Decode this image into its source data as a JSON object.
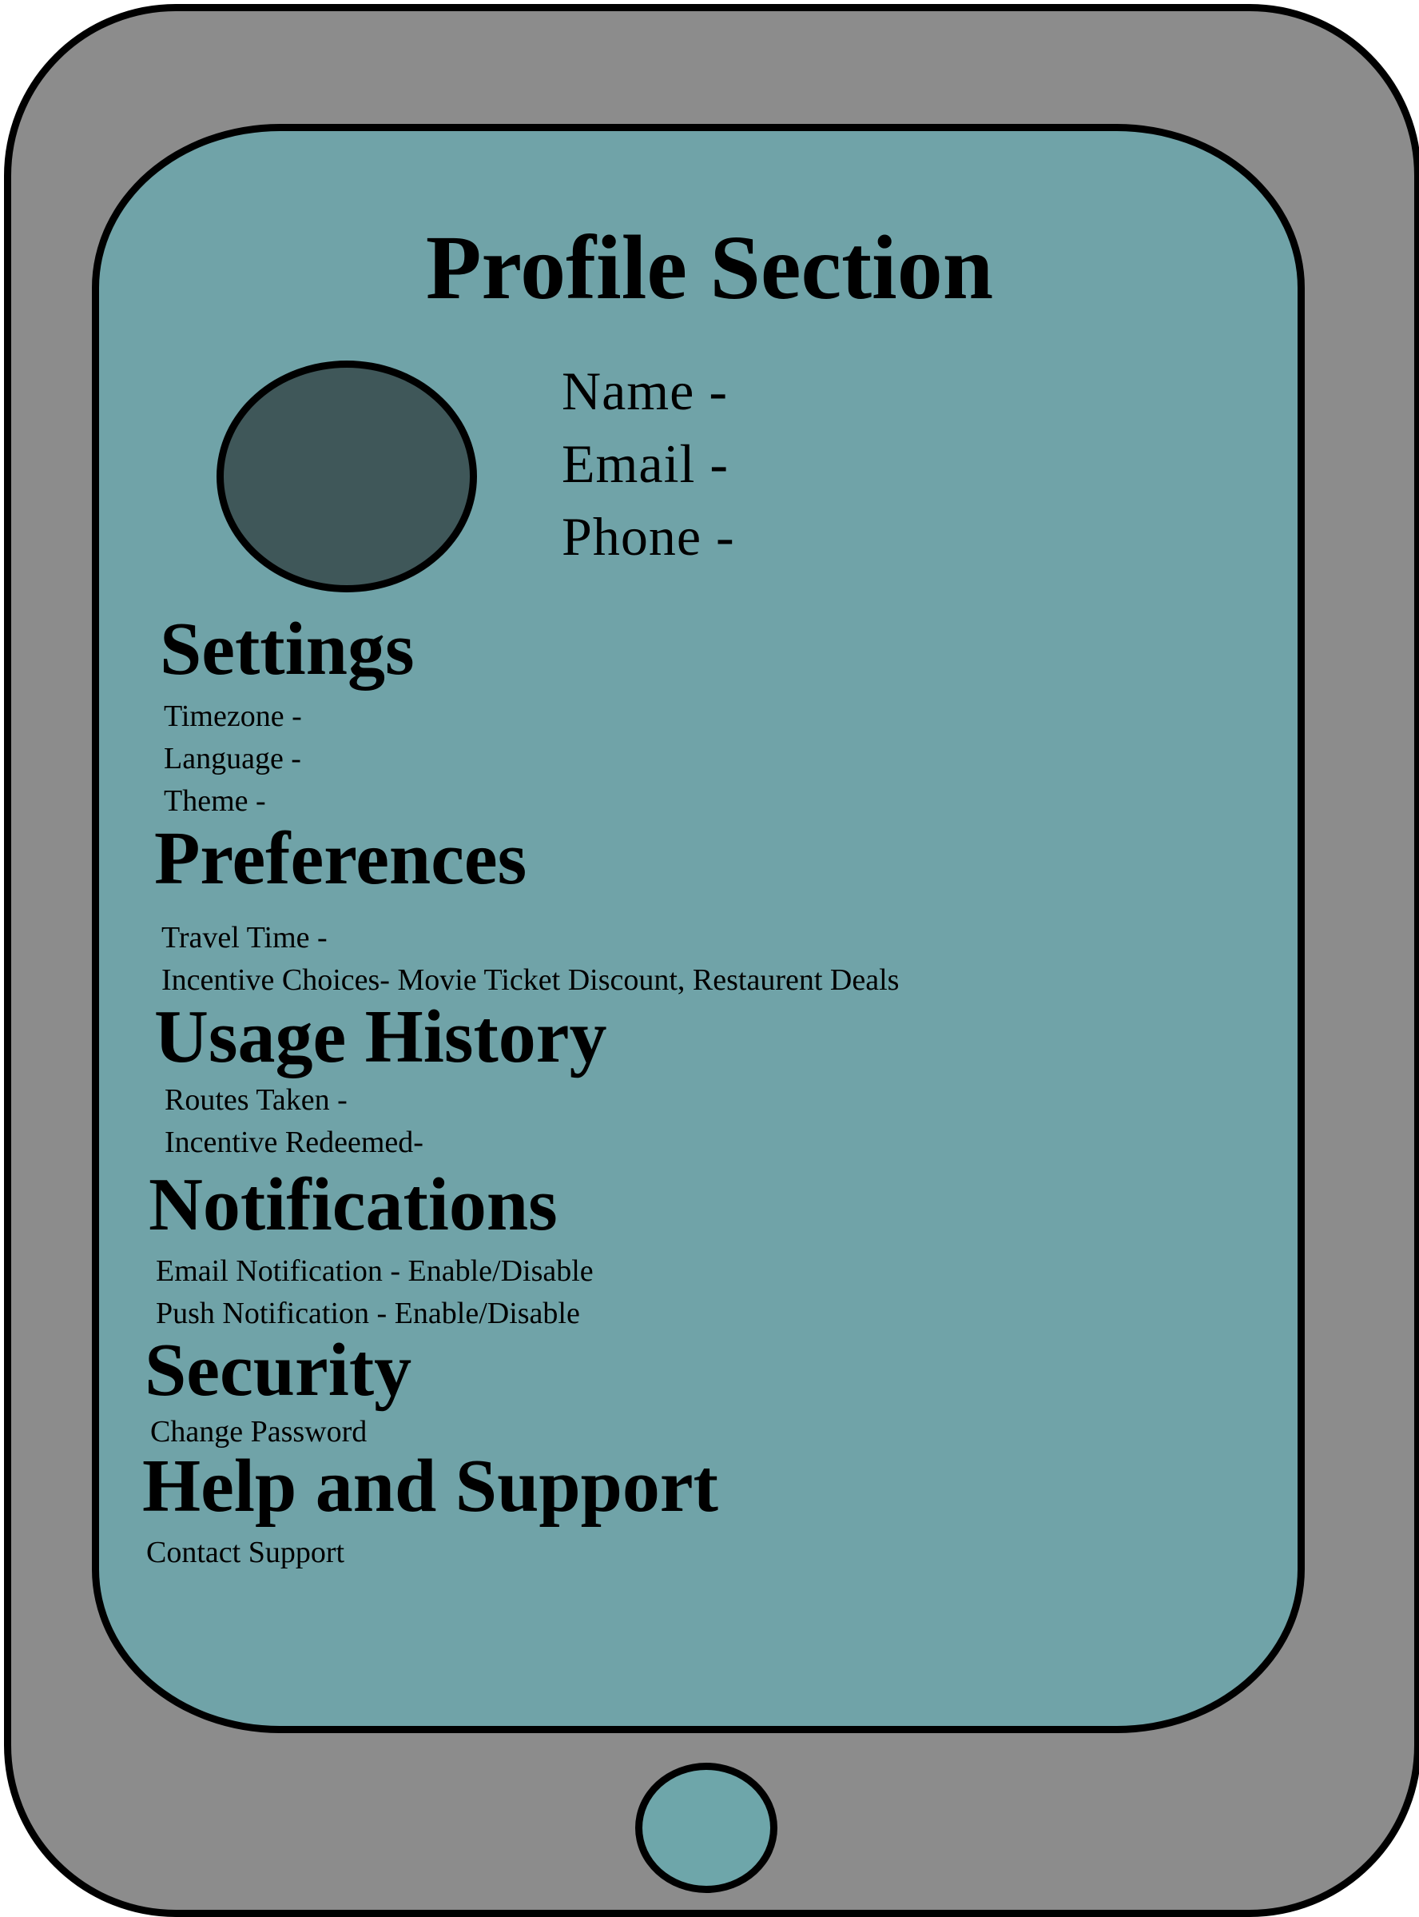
{
  "screen": {
    "title": "Profile Section"
  },
  "profile": {
    "name_label": "Name -",
    "email_label": "Email -",
    "phone_label": "Phone -"
  },
  "settings": {
    "heading": "Settings",
    "items": [
      "Timezone -",
      "Language -",
      "Theme -"
    ]
  },
  "preferences": {
    "heading": "Preferences",
    "items": [
      "Travel Time -",
      "Incentive Choices- Movie Ticket Discount, Restaurent Deals"
    ]
  },
  "usage_history": {
    "heading": "Usage History",
    "items": [
      "Routes Taken -",
      "Incentive Redeemed-"
    ]
  },
  "notifications": {
    "heading": "Notifications",
    "items": [
      "Email Notification - Enable/Disable",
      "Push Notification - Enable/Disable"
    ]
  },
  "security": {
    "heading": "Security",
    "items": [
      "Change Password"
    ]
  },
  "help_support": {
    "heading": "Help and Support",
    "items": [
      "Contact Support"
    ]
  },
  "colors": {
    "device_frame": "#8c8c8c",
    "screen": "#70a3a8",
    "avatar": "#3f5759",
    "home_button": "#6ea6aa",
    "outline": "#000000"
  }
}
